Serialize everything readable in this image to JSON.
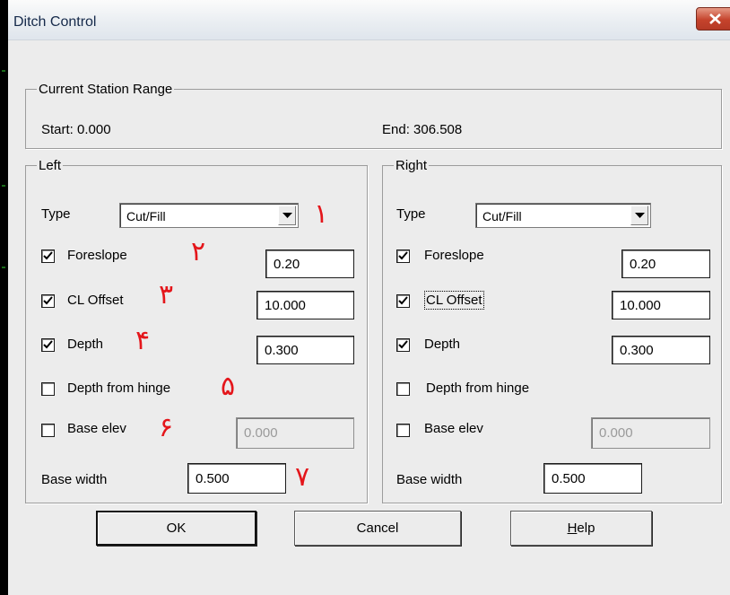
{
  "window": {
    "title": "Ditch Control"
  },
  "station_range": {
    "legend": "Current Station Range",
    "start": "Start: 0.000",
    "end": "End: 306.508"
  },
  "left": {
    "legend": "Left",
    "type_label": "Type",
    "type_value": "Cut/Fill",
    "foreslope": {
      "label": "Foreslope",
      "checked": true,
      "value": "0.20"
    },
    "cl_offset": {
      "label": "CL Offset",
      "checked": true,
      "value": "10.000"
    },
    "depth": {
      "label": "Depth",
      "checked": true,
      "value": "0.300"
    },
    "depth_from_hinge": {
      "label": "Depth from hinge",
      "checked": false
    },
    "base_elev": {
      "label": "Base elev",
      "checked": false,
      "value": "0.000"
    },
    "base_width": {
      "label": "Base width",
      "value": "0.500"
    }
  },
  "right": {
    "legend": "Right",
    "type_label": "Type",
    "type_value": "Cut/Fill",
    "foreslope": {
      "label": "Foreslope",
      "checked": true,
      "value": "0.20"
    },
    "cl_offset": {
      "label": "CL Offset",
      "checked": true,
      "value": "10.000"
    },
    "depth": {
      "label": "Depth",
      "checked": true,
      "value": "0.300"
    },
    "depth_from_hinge": {
      "label": "Depth from hinge",
      "checked": false
    },
    "base_elev": {
      "label": "Base elev",
      "checked": false,
      "value": "0.000"
    },
    "base_width": {
      "label": "Base width",
      "value": "0.500"
    }
  },
  "annotations": [
    "١",
    "٢",
    "٣",
    "۴",
    "۵",
    "۶",
    "٧"
  ],
  "buttons": {
    "ok": "OK",
    "cancel": "Cancel",
    "help_accel": "H",
    "help_rest": "elp"
  },
  "colors": {
    "annotation": "#e4161b",
    "close_button": "#c5432c",
    "title_text": "#15294a"
  }
}
